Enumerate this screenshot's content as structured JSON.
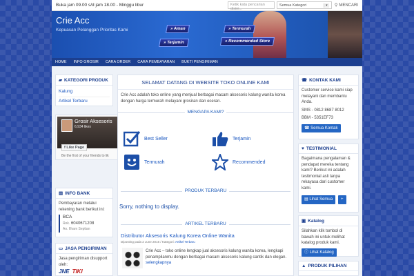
{
  "topbar": {
    "hours": "Buka jam 09.00 s/d jam 18.00 - Minggu libur",
    "search_placeholder": "Ketik kata pencarian disini...",
    "category_select": "Semua Kategori",
    "search_button": "MENCARI"
  },
  "header": {
    "site_title": "Crie Acc",
    "tagline": "Kepuasan Pelanggan Prioritas Kami",
    "banner_tags": [
      "» Aman",
      "» Termurah",
      "» Terjamin",
      "» Recommended Store"
    ]
  },
  "nav": [
    "HOME",
    "INFO GROSIR",
    "CARA ORDER",
    "CARA PEMBAYARAN",
    "BUKTI PENGIRIMAN"
  ],
  "left": {
    "kategori": {
      "title": "KATEGORI PRODUK",
      "items": [
        "Kalung",
        "Artikel Terbaru"
      ]
    },
    "facebook": {
      "page_name": "Grosir Aksesoris",
      "likes": "6,934 likes",
      "like_button": "Like Page",
      "friends_text": "Be the first of your friends to lik"
    },
    "bank": {
      "title": "INFO BANK",
      "text": "Pembayaran melalui rekening bank berikut ini:",
      "bank_name": "BCA",
      "rek_label": "Rek.",
      "rek_no": "6040671208",
      "an_label": "An.",
      "an_name": "Ilham Septian"
    },
    "shipping": {
      "title": "JASA PENGIRIMAN",
      "text": "Jasa pengiriman disupport oleh:",
      "logos": [
        "JNE",
        "TIKI"
      ]
    }
  },
  "main": {
    "welcome_title": "SELAMAT DATANG DI WEBSITE TOKO ONLINE KAMI",
    "welcome_text": "Crie Acc adalah toko online yang menjual berbagai macam aksesoris kalung wanita korea dengan harga termurah melayani grosiran dan eceran.",
    "why_title": "MENGAPA KAMI?",
    "features": [
      "Best Seller",
      "Terjamin",
      "Termurah",
      "Recommended"
    ],
    "products_title": "PRODUK TERBARU",
    "no_products": "Sorry, nothing to display.",
    "articles_title": "ARTIKEL TERBARU",
    "article": {
      "title": "Distributor Aksesoris Kalung Korea Online Wanita",
      "meta_prefix": "Diposting pada",
      "meta_date": "2 June 2016",
      "meta_sep": "/ Kategori:",
      "meta_cat": "Artikel Terbaru",
      "excerpt": "Crie Acc – toko online lengkap jual aksesoris kalung wanita korea, lengkapi penampilanmu dengan berbagai macam aksesoris kalung cantik dan elegan.",
      "read_more": "selengkapnya"
    }
  },
  "right": {
    "kontak": {
      "title": "KONTAK KAMI",
      "text": "Customer service kami siap melayani dan membantu Anda.",
      "sms": "SMS - 0812 8687 8012",
      "bbm": "BBM - 5351EF73",
      "button": "Semua Kontak"
    },
    "testimonial": {
      "title": "TESTIMONIAL",
      "text": "Bagaimana pengalaman & pendapat mereka tentang kami? Berikut ini adalah testimonial asli tanpa rekayasa dari customer kami.",
      "button": "Lihat Semua",
      "plus": "+"
    },
    "katalog": {
      "title": "Katalog",
      "text": "Silahkan klik tombol di bawah ini untuk melihat katalog produk kami.",
      "button": "Lihat Katalog"
    },
    "pilihan": {
      "title": "PRODUK PILIHAN"
    }
  },
  "colors": {
    "brand_blue": "#1c3f8f",
    "link_blue": "#1a57c0",
    "button_blue": "#2466c4"
  }
}
